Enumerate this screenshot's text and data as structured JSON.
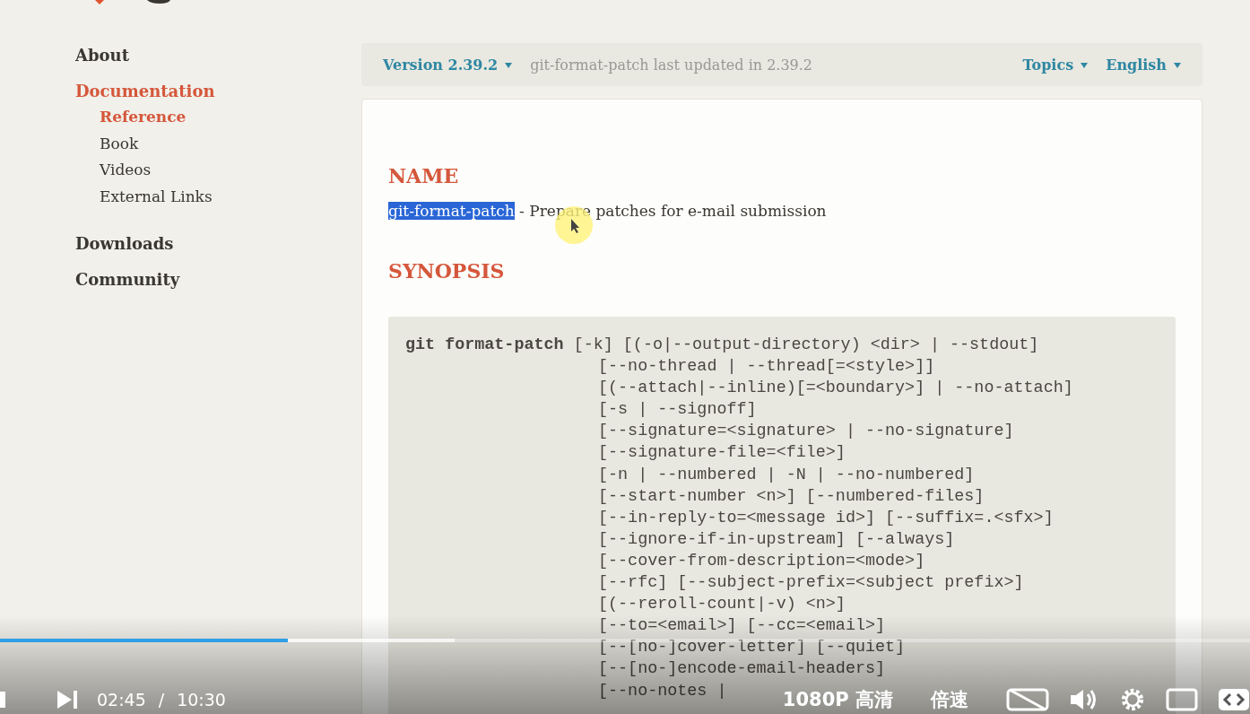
{
  "sidebar": {
    "items": [
      {
        "label": "About",
        "selected": false
      },
      {
        "label": "Documentation",
        "selected": true,
        "children": [
          {
            "label": "Reference",
            "selected": true
          },
          {
            "label": "Book",
            "selected": false
          },
          {
            "label": "Videos",
            "selected": false
          },
          {
            "label": "External Links",
            "selected": false
          }
        ]
      },
      {
        "label": "Downloads",
        "selected": false
      },
      {
        "label": "Community",
        "selected": false
      }
    ]
  },
  "topbar": {
    "version": "Version 2.39.2",
    "updated": "git-format-patch last updated in 2.39.2",
    "menus": [
      "Topics",
      "English"
    ]
  },
  "name_section": {
    "heading": "NAME",
    "selected_text": "git-format-patch",
    "rest": " - Prepare patches for e-mail submission"
  },
  "synopsis": {
    "heading": "SYNOPSIS",
    "lines": [
      "**git format-patch** [-k] [(-o|--output-directory) <dir> | --stdout]",
      "[--no-thread | --thread[=<style>]]",
      "[(--attach|--inline)[=<boundary>] | --no-attach]",
      "[-s | --signoff]",
      "[--signature=<signature> | --no-signature]",
      "[--signature-file=<file>]",
      "[-n | --numbered | -N | --no-numbered]",
      "[--start-number <n>] [--numbered-files]",
      "[--in-reply-to=<message id>] [--suffix=.<sfx>]",
      "[--ignore-if-in-upstream] [--always]",
      "[--cover-from-description=<mode>]",
      "[--rfc] [--subject-prefix=<subject prefix>]",
      "[(--reroll-count|-v) <n>]",
      "[--to=<email>] [--cc=<email>]",
      "[--[no-]cover-letter] [--quiet]",
      "[--[no-]encode-email-headers]",
      "[--no-notes |"
    ]
  },
  "player": {
    "progress": {
      "level": 0.23
    },
    "buffer": {
      "level": 0.364
    },
    "time": "02:45",
    "separator": "/",
    "duration": "10:30",
    "quality": "1080P 高清",
    "speed": "倍速"
  }
}
